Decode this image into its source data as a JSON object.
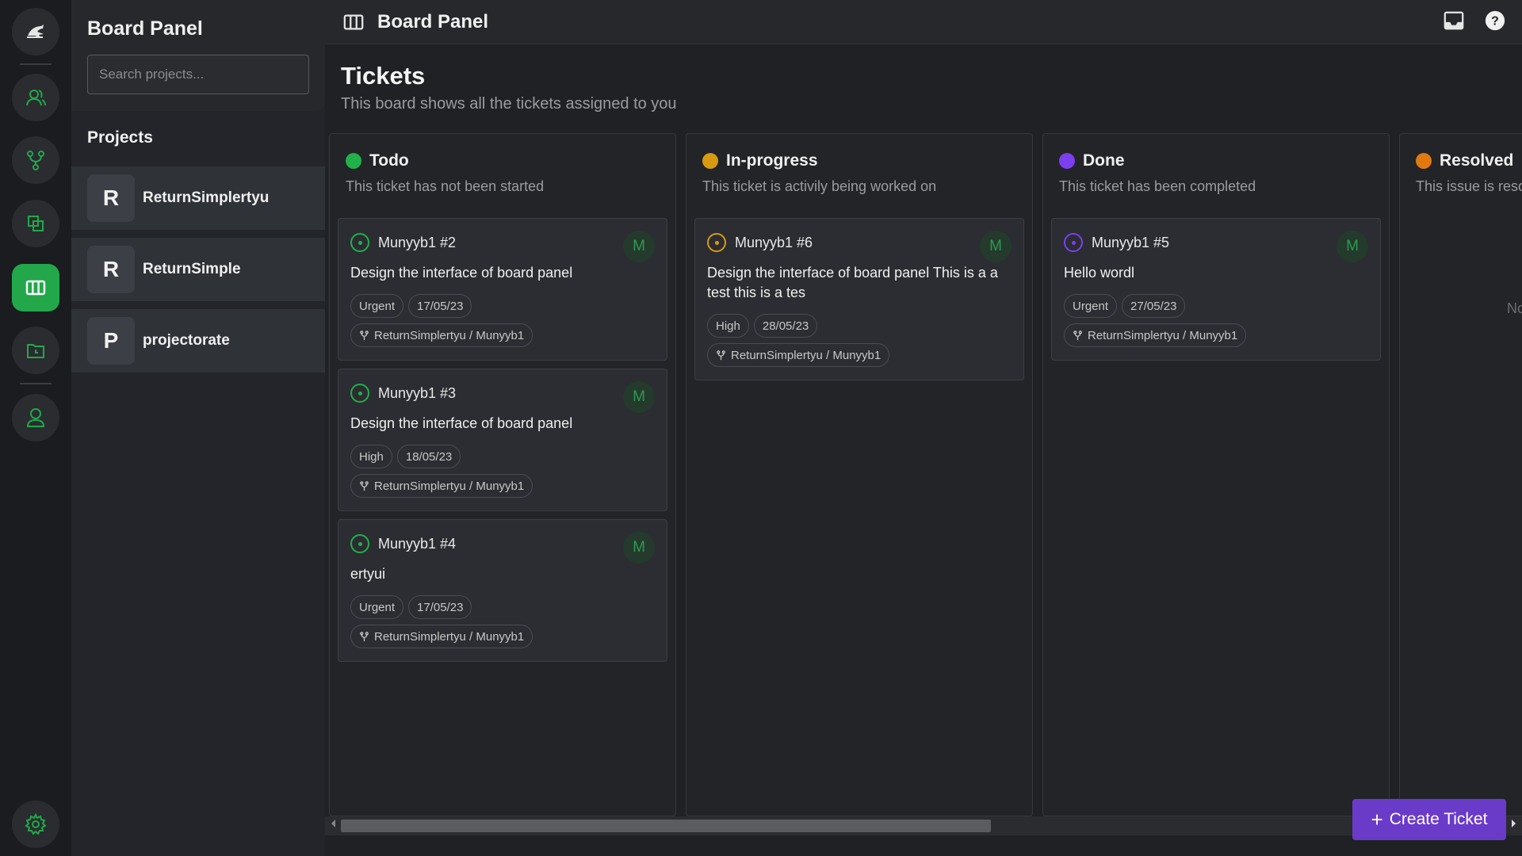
{
  "colors": {
    "accent_green": "#22a84a",
    "todo": "#22b04a",
    "inprogress": "#d89a12",
    "done": "#7b3ff0",
    "resolved": "#e07a10",
    "create_button": "#6a3bc9"
  },
  "rail": {
    "items": [
      {
        "icon": "logo-icon"
      },
      {
        "icon": "users-icon"
      },
      {
        "icon": "git-branch-icon"
      },
      {
        "icon": "layers-icon"
      },
      {
        "icon": "board-columns-icon",
        "active": true
      },
      {
        "icon": "calendar-folder-icon"
      },
      {
        "icon": "user-profile-icon"
      },
      {
        "icon": "settings-gear-icon"
      }
    ]
  },
  "sidebar": {
    "title": "Board Panel",
    "search_placeholder": "Search projects...",
    "projects_heading": "Projects",
    "projects": [
      {
        "initial": "R",
        "name": "ReturnSimplertyu"
      },
      {
        "initial": "R",
        "name": "ReturnSimple"
      },
      {
        "initial": "P",
        "name": "projectorate"
      }
    ]
  },
  "header": {
    "title": "Board Panel",
    "icons": [
      "board-columns-icon",
      "inbox-icon",
      "help-icon"
    ]
  },
  "page": {
    "title": "Tickets",
    "subtitle": "This board shows all the tickets assigned to you"
  },
  "columns": [
    {
      "title": "Todo",
      "description": "This ticket has not been started",
      "cards": [
        {
          "id": "Munyyb1 #2",
          "text": "Design the interface of board panel",
          "priority": "Urgent",
          "date": "17/05/23",
          "repo": "ReturnSimplertyu / Munyyb1",
          "assignee": "M"
        },
        {
          "id": "Munyyb1 #3",
          "text": "Design the interface of board panel",
          "priority": "High",
          "date": "18/05/23",
          "repo": "ReturnSimplertyu / Munyyb1",
          "assignee": "M"
        },
        {
          "id": "Munyyb1 #4",
          "text": "ertyui",
          "priority": "Urgent",
          "date": "17/05/23",
          "repo": "ReturnSimplertyu / Munyyb1",
          "assignee": "M"
        }
      ]
    },
    {
      "title": "In-progress",
      "description": "This ticket is activily being worked on",
      "cards": [
        {
          "id": "Munyyb1 #6",
          "text": "Design the interface of board panel This is a a test this is a tes",
          "priority": "High",
          "date": "28/05/23",
          "repo": "ReturnSimplertyu / Munyyb1",
          "assignee": "M"
        }
      ]
    },
    {
      "title": "Done",
      "description": "This ticket has been completed",
      "cards": [
        {
          "id": "Munyyb1 #5",
          "text": "Hello wordl",
          "priority": "Urgent",
          "date": "27/05/23",
          "repo": "ReturnSimplertyu / Munyyb1",
          "assignee": "M"
        }
      ]
    },
    {
      "title": "Resolved",
      "description": "This issue is reso",
      "empty_text": "Nc",
      "cards": []
    }
  ],
  "create_button": {
    "label": "Create Ticket"
  }
}
